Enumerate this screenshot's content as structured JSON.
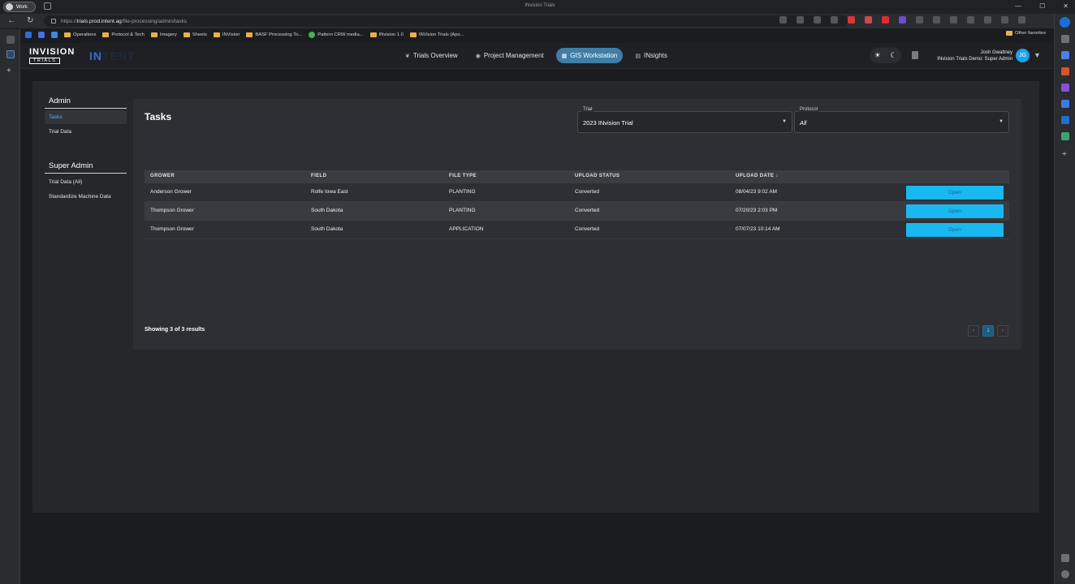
{
  "browser": {
    "profile_label": "Work",
    "window_title": "INvision Trials",
    "url_prefix": "https://",
    "url_host": "trials.prod.intent.ag",
    "url_path": "/file-processing/admin/tasks",
    "window_controls": [
      "—",
      "☐",
      "✕"
    ],
    "bookmarks": [
      {
        "label": "Operations",
        "kind": "folder"
      },
      {
        "label": "Protocol & Tech",
        "kind": "folder"
      },
      {
        "label": "Imagery",
        "kind": "folder"
      },
      {
        "label": "Sheets",
        "kind": "folder"
      },
      {
        "label": "INVision",
        "kind": "folder"
      },
      {
        "label": "BASF Processing To...",
        "kind": "folder"
      },
      {
        "label": "Pattern CRW media...",
        "kind": "site"
      },
      {
        "label": "INvision 1.0",
        "kind": "folder"
      },
      {
        "label": "INVision Trials (Apo...",
        "kind": "folder"
      }
    ],
    "other_favorites": "Other favorites"
  },
  "app": {
    "logo_main": "INVISION",
    "logo_sub": "TRIALS",
    "logo_brand_prefix": "IN",
    "logo_brand_rest": "TENT",
    "nav": [
      {
        "label": "Trials Overview",
        "icon": "leaf-icon",
        "glyph": "❦",
        "active": false
      },
      {
        "label": "Project Management",
        "icon": "pin-icon",
        "glyph": "◉",
        "active": false
      },
      {
        "label": "GIS Workstation",
        "icon": "grid-icon",
        "glyph": "▦",
        "active": true
      },
      {
        "label": "INsights",
        "icon": "chart-icon",
        "glyph": "▤",
        "active": false
      }
    ],
    "theme_toggle": {
      "light": "☀",
      "dark": "☾"
    },
    "user": {
      "name": "Josh Gwaltney",
      "role": "INvision Trials Demo: Super Admin",
      "initials": "JG"
    }
  },
  "sidebar": {
    "admin_title": "Admin",
    "admin_items": [
      {
        "label": "Tasks",
        "active": true
      },
      {
        "label": "Trial Data",
        "active": false
      }
    ],
    "super_title": "Super Admin",
    "super_items": [
      {
        "label": "Trial Data (All)"
      },
      {
        "label": "Standardize Machine Data"
      }
    ]
  },
  "tasks": {
    "title": "Tasks",
    "trial_select": {
      "label": "Trial",
      "value": "2023 INvision Trial"
    },
    "protocol_select": {
      "label": "Protocol",
      "value": "All"
    },
    "columns": [
      "GROWER",
      "FIELD",
      "FILE TYPE",
      "UPLOAD STATUS",
      "UPLOAD DATE"
    ],
    "sort_indicator": "↓",
    "rows": [
      {
        "grower": "Anderson Grower",
        "field": "Rolfe Iowa East",
        "file_type": "PLANTING",
        "status": "Converted",
        "date": "08/04/23 9:02 AM",
        "action": "Open"
      },
      {
        "grower": "Thompson Grower",
        "field": "South Dakota",
        "file_type": "PLANTING",
        "status": "Converted",
        "date": "07/20/23 2:03 PM",
        "action": "Open"
      },
      {
        "grower": "Thompson Grower",
        "field": "South Dakota",
        "file_type": "APPLICATION",
        "status": "Converted",
        "date": "07/07/23 10:14 AM",
        "action": "Open"
      }
    ],
    "results_text": "Showing 3 of 3 results",
    "pagination": {
      "prev": "‹",
      "current": "1",
      "next": "›"
    }
  }
}
